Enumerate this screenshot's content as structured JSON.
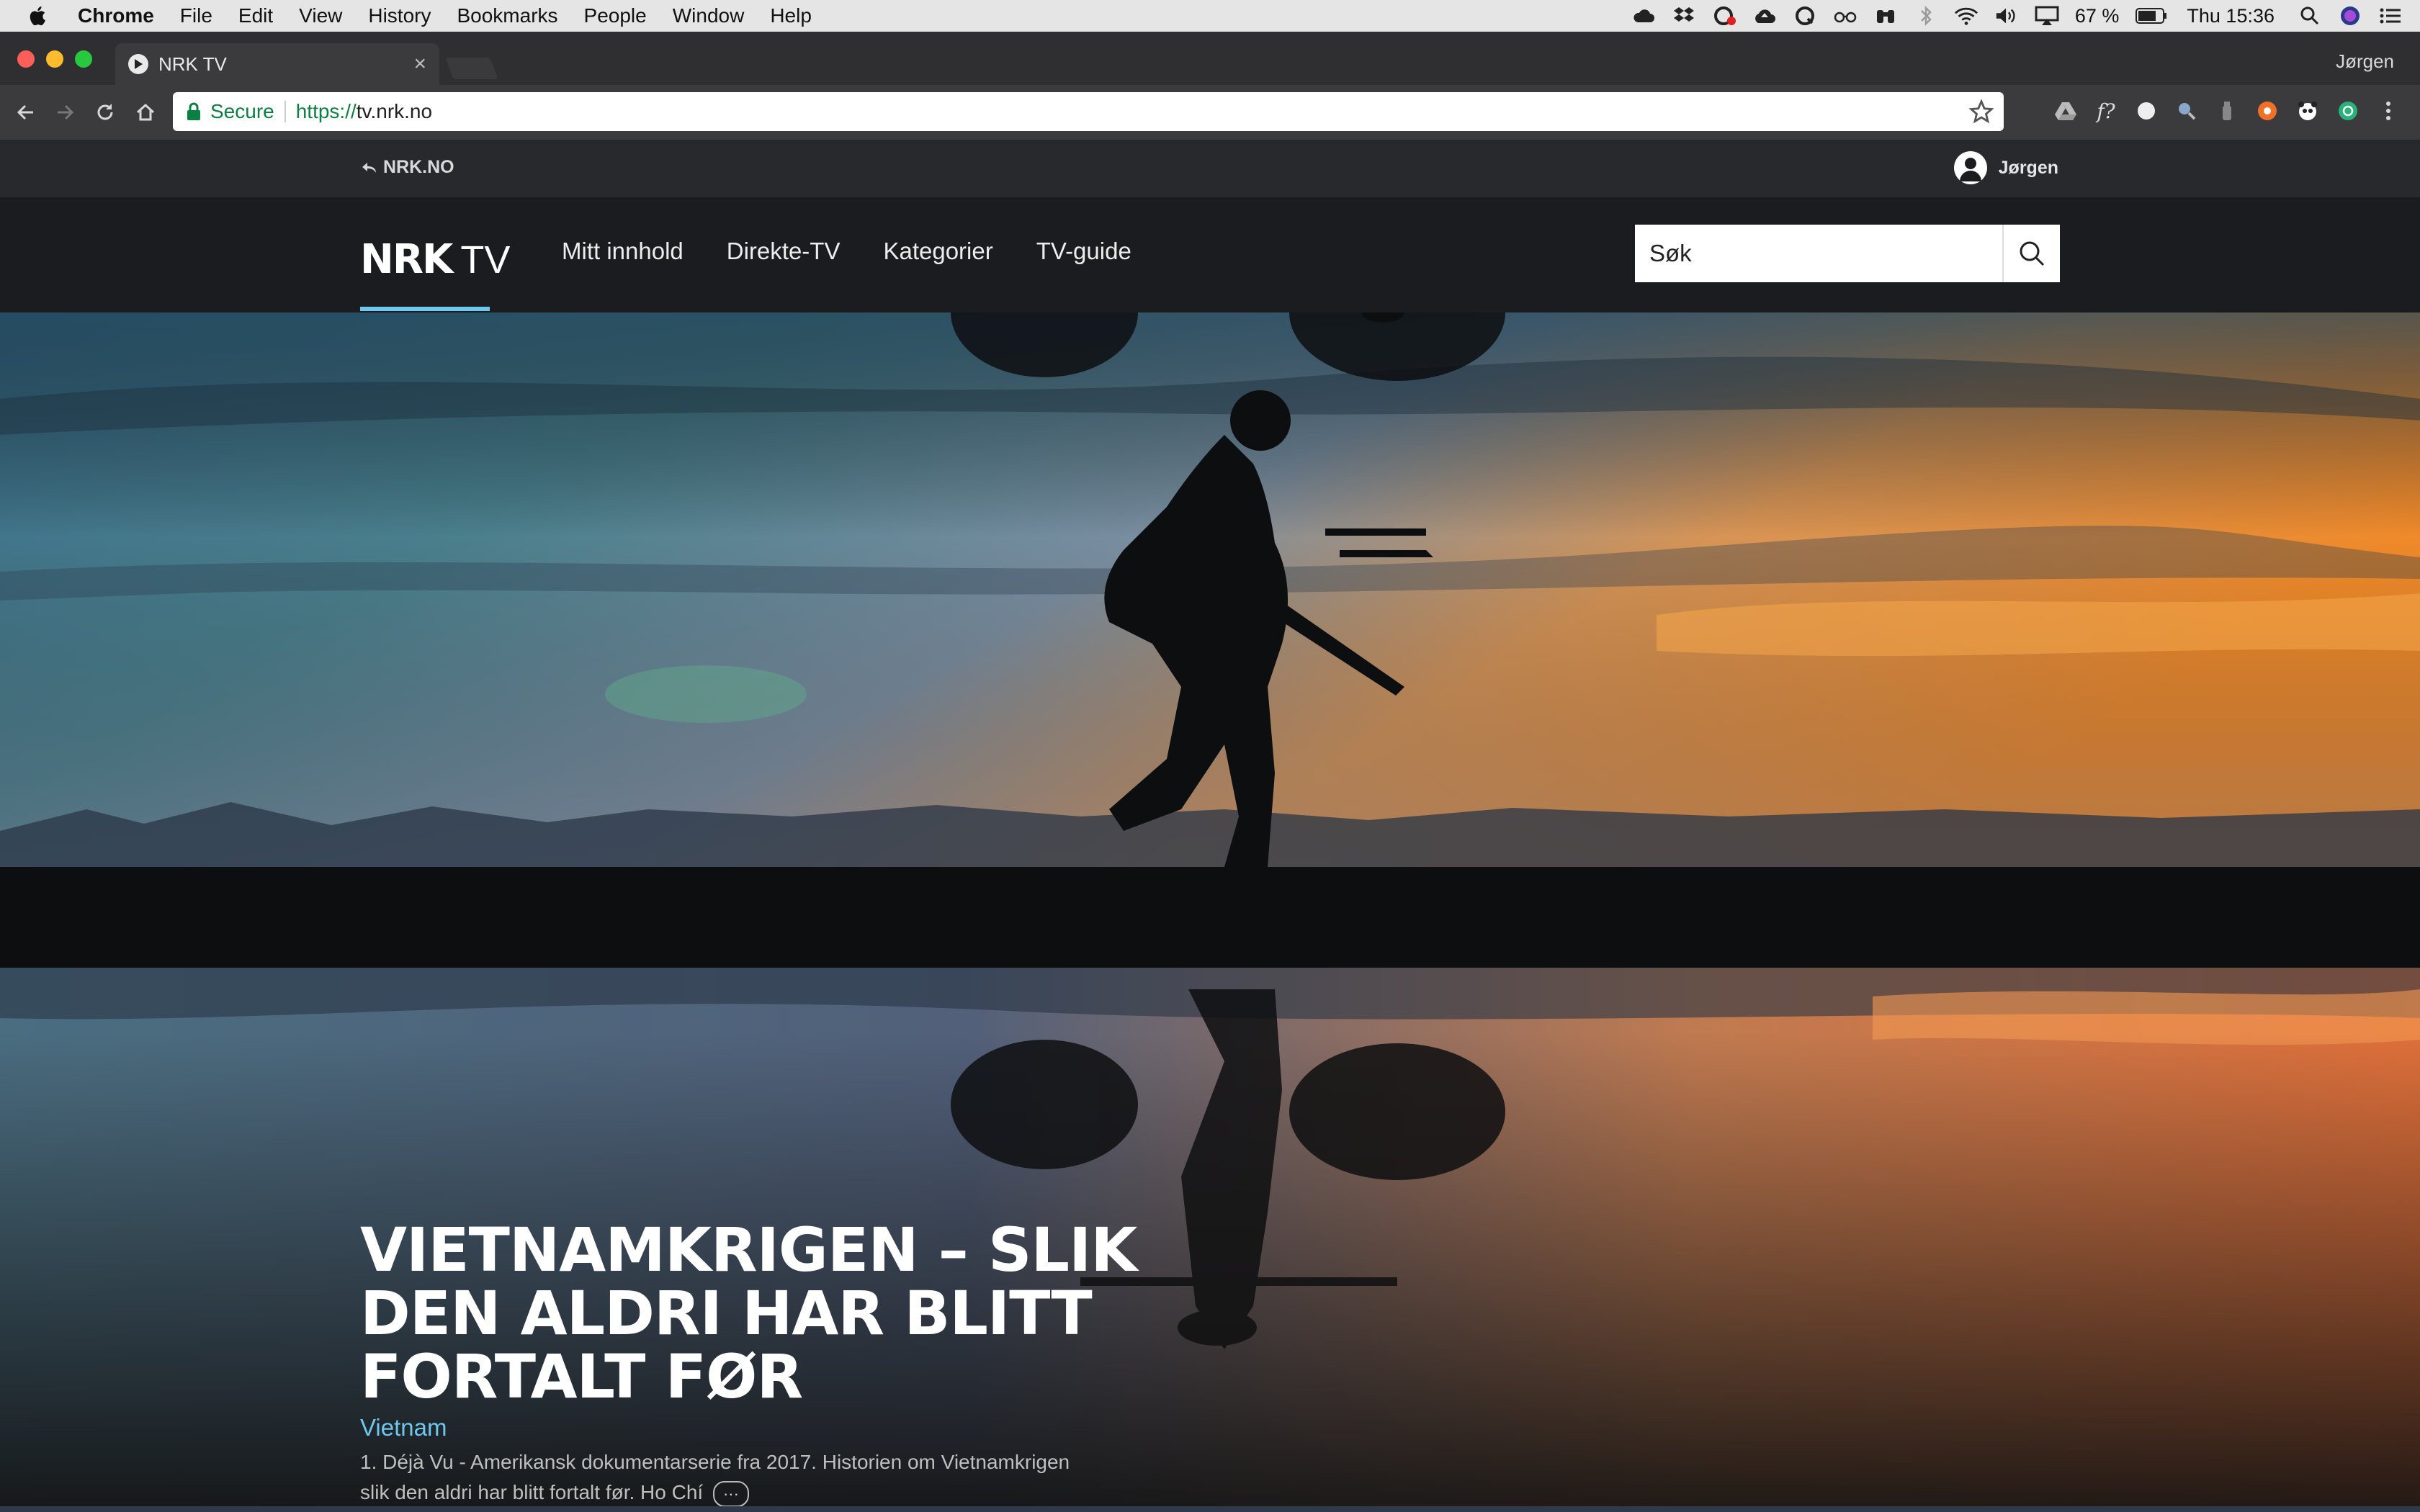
{
  "menubar": {
    "app": "Chrome",
    "items": [
      "File",
      "Edit",
      "View",
      "History",
      "Bookmarks",
      "People",
      "Window",
      "Help"
    ],
    "battery": "67 %",
    "clock": "Thu 15:36"
  },
  "browser": {
    "tab_title": "NRK TV",
    "profile_name": "Jørgen",
    "secure_label": "Secure",
    "url_protocol": "https://",
    "url_host": "tv.nrk.no"
  },
  "nrk": {
    "back_link": "NRK.NO",
    "user_name": "Jørgen",
    "logo_nrk": "NRK",
    "logo_tv": "TV",
    "nav": [
      "Mitt innhold",
      "Direkte-TV",
      "Kategorier",
      "TV-guide"
    ],
    "search_placeholder": "Søk",
    "hero": {
      "title": "VIETNAMKRIGEN – SLIK DEN ALDRI HAR BLITT FORTALT FØR",
      "series": "Vietnam",
      "description": "1. Déjà Vu - Amerikansk dokumentarserie fra 2017. Historien om Vietnamkrigen slik den aldri har blitt fortalt før. Ho Chí",
      "more_glyph": "···"
    }
  },
  "colors": {
    "accent": "#6fc8ec",
    "header_bg": "#1b1c1f",
    "secure_green": "#0b8043"
  }
}
